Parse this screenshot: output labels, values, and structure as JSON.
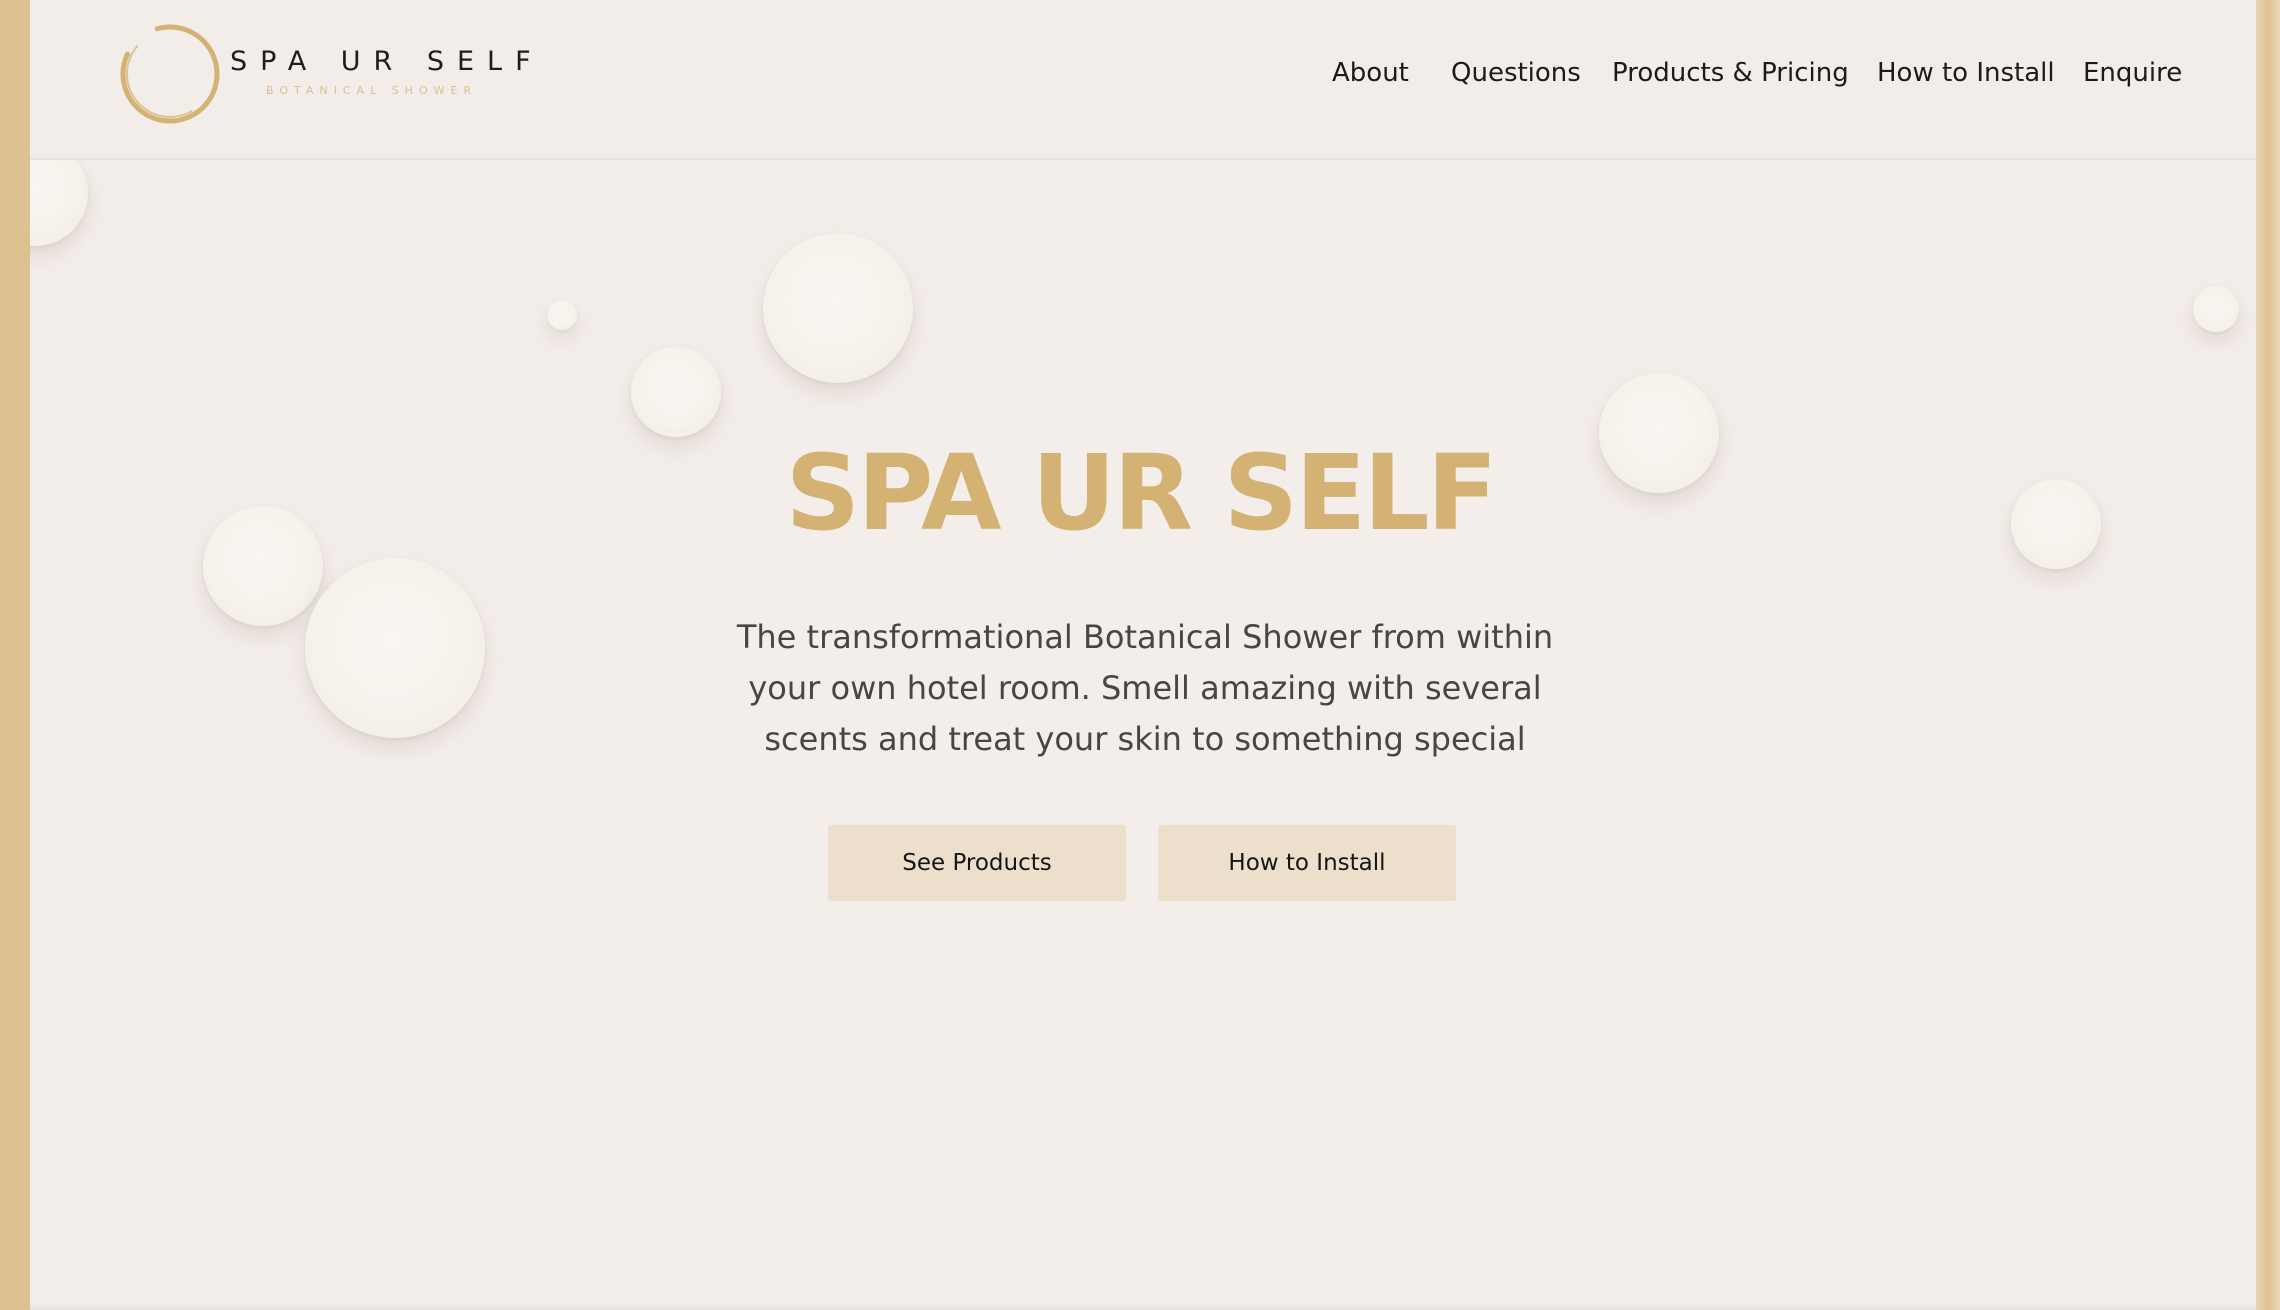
{
  "brand": {
    "name": "SPA UR SELF",
    "tagline": "BOTANICAL SHOWER",
    "accent_color": "#d3b273",
    "rail_color": "#dcc290"
  },
  "nav": {
    "items": [
      {
        "label": "About"
      },
      {
        "label": "Questions"
      },
      {
        "label": "Products & Pricing"
      },
      {
        "label": "How to Install"
      },
      {
        "label": "Enquire"
      }
    ]
  },
  "hero": {
    "title": "SPA UR SELF",
    "description": "The transformational Botanical Shower from within your own hotel room. Smell amazing with several scents and treat your skin to something special",
    "buttons": {
      "primary": "See Products",
      "secondary": "How to Install"
    }
  }
}
